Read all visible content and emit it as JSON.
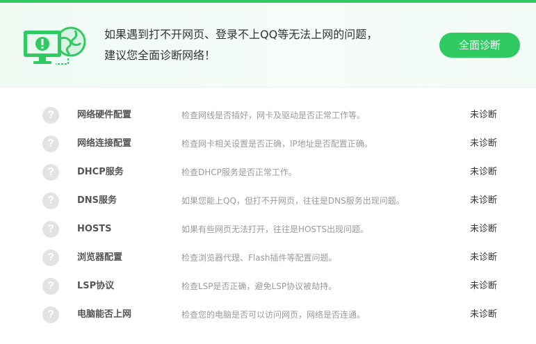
{
  "header": {
    "message_line1": "如果遇到打不开网页、登录不上QQ等无法上网的问题，",
    "message_line2": "建议您全面诊断网络！",
    "diagnose_button": "全面诊断",
    "illustration_icon": "monitor-alert-globe-icon",
    "accent_color": "#2fca62"
  },
  "items": [
    {
      "icon": "question-icon",
      "name": "网络硬件配置",
      "desc": "检查网线是否插好，网卡及驱动是否正常工作等。",
      "status": "未诊断"
    },
    {
      "icon": "question-icon",
      "name": "网络连接配置",
      "desc": "检查网卡相关设置是否正确，IP地址是否配置正确。",
      "status": "未诊断"
    },
    {
      "icon": "question-icon",
      "name": "DHCP服务",
      "desc": "检查DHCP服务是否正常工作。",
      "status": "未诊断"
    },
    {
      "icon": "question-icon",
      "name": "DNS服务",
      "desc": "如果您能上QQ，但打不开网页，往往是DNS服务出现问题。",
      "status": "未诊断"
    },
    {
      "icon": "question-icon",
      "name": "HOSTS",
      "desc": "如果有些网页无法打开，往往是HOSTS出现问题。",
      "status": "未诊断"
    },
    {
      "icon": "question-icon",
      "name": "浏览器配置",
      "desc": "检查浏览器代理、Flash插件等配置问题。",
      "status": "未诊断"
    },
    {
      "icon": "question-icon",
      "name": "LSP协议",
      "desc": "检查LSP是否正确，避免LSP协议被劫持。",
      "status": "未诊断"
    },
    {
      "icon": "question-icon",
      "name": "电脑能否上网",
      "desc": "检查您的电脑是否可以访问网页，网络是否连通。",
      "status": "未诊断"
    }
  ]
}
